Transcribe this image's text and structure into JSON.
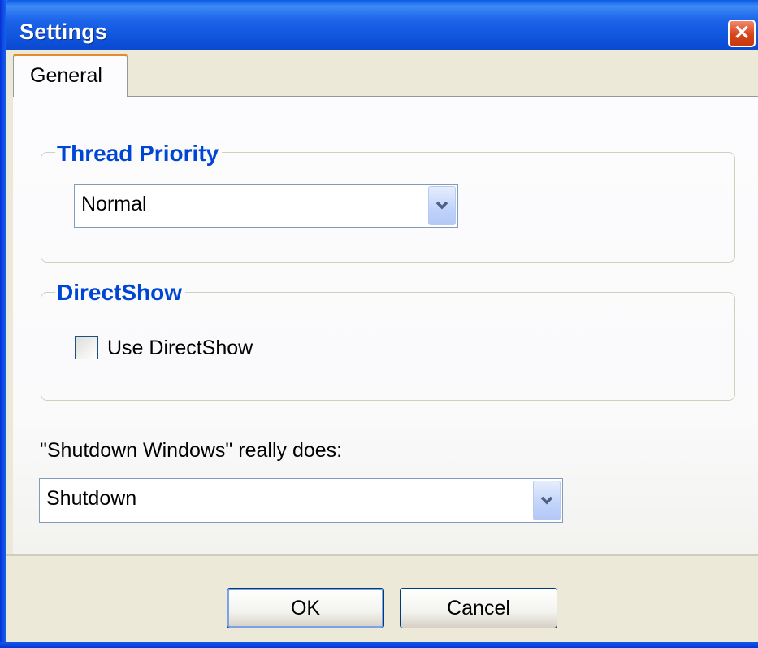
{
  "window": {
    "title": "Settings"
  },
  "tabs": [
    {
      "label": "General",
      "selected": true
    }
  ],
  "thread_priority": {
    "title": "Thread Priority",
    "selected": "Normal"
  },
  "directshow": {
    "title": "DirectShow",
    "checkbox_label": "Use DirectShow",
    "checked": false
  },
  "shutdown": {
    "label": "\"Shutdown Windows\" really does:",
    "selected": "Shutdown"
  },
  "buttons": {
    "ok": "OK",
    "cancel": "Cancel"
  },
  "colors": {
    "titlebar": "#0a5ae4",
    "group_title": "#0046d5",
    "tab_highlight": "#e68b2c",
    "close": "#d8431a"
  }
}
